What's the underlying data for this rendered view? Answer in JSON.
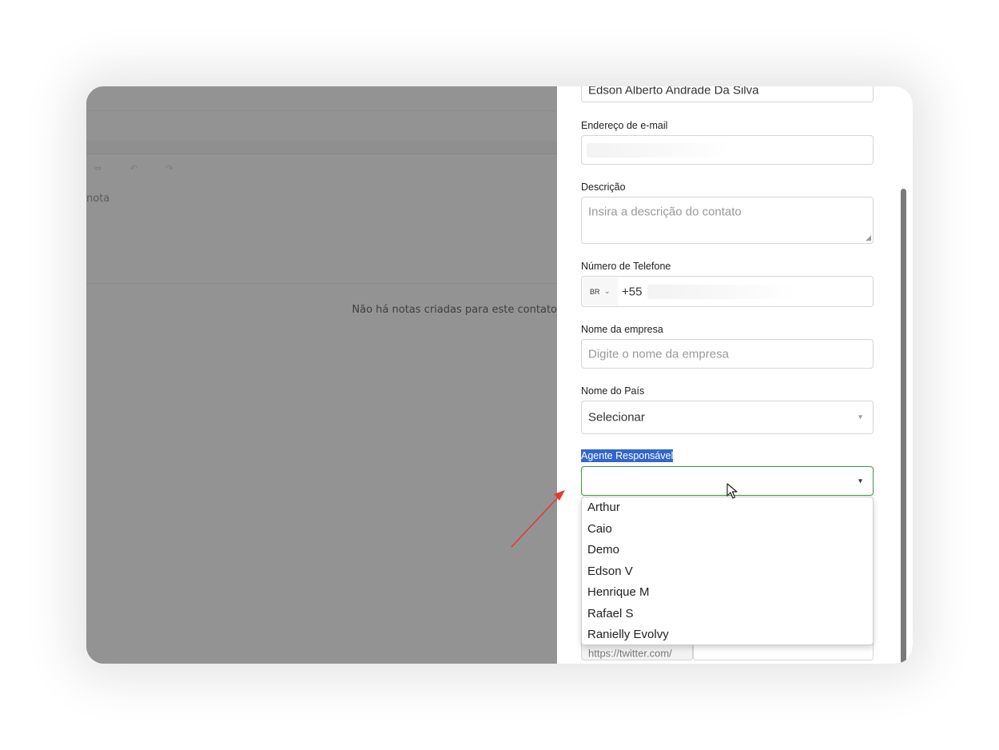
{
  "background": {
    "note_fragment": "nota",
    "empty_notes_message": "Não há notas criadas para este contato",
    "toolbar_glyphs": "⇔ ↶ ↷"
  },
  "form": {
    "name_value": "Edson Alberto Andrade Da Silva",
    "email_label": "Endereço de e-mail",
    "description_label": "Descrição",
    "description_placeholder": "Insira a descrição do contato",
    "phone_label": "Número de Telefone",
    "phone_country": "BR",
    "phone_prefix": "+55",
    "company_label": "Nome da empresa",
    "company_placeholder": "Digite o nome da empresa",
    "country_label": "Nome do País",
    "country_value": "Selecionar",
    "agent_label": "Agente Responsável",
    "agent_value": "",
    "twitter_prefix": "https://twitter.com/"
  },
  "agent_options": [
    "Arthur",
    "Caio",
    "Demo",
    "Edson V",
    "Henrique M",
    "Rafael S",
    "Ranielly Evolvy"
  ],
  "colors": {
    "overlay": "#939393",
    "highlight": "#3366cc",
    "focus_border": "#3a9b3a",
    "annotation_arrow": "#e53935"
  },
  "icons": {
    "chevron": "chevron-down-icon",
    "cursor": "mouse-pointer-icon",
    "annotation": "red-arrow-annotation"
  }
}
